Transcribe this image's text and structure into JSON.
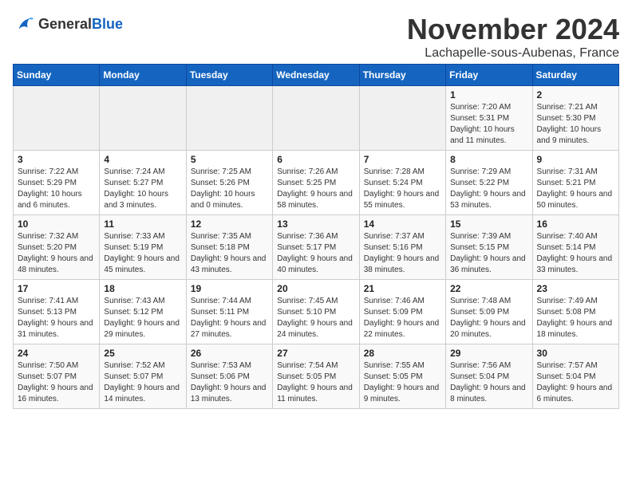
{
  "header": {
    "logo_general": "General",
    "logo_blue": "Blue",
    "month_title": "November 2024",
    "subtitle": "Lachapelle-sous-Aubenas, France"
  },
  "days_of_week": [
    "Sunday",
    "Monday",
    "Tuesday",
    "Wednesday",
    "Thursday",
    "Friday",
    "Saturday"
  ],
  "weeks": [
    [
      {
        "day": "",
        "info": ""
      },
      {
        "day": "",
        "info": ""
      },
      {
        "day": "",
        "info": ""
      },
      {
        "day": "",
        "info": ""
      },
      {
        "day": "",
        "info": ""
      },
      {
        "day": "1",
        "info": "Sunrise: 7:20 AM\nSunset: 5:31 PM\nDaylight: 10 hours and 11 minutes."
      },
      {
        "day": "2",
        "info": "Sunrise: 7:21 AM\nSunset: 5:30 PM\nDaylight: 10 hours and 9 minutes."
      }
    ],
    [
      {
        "day": "3",
        "info": "Sunrise: 7:22 AM\nSunset: 5:29 PM\nDaylight: 10 hours and 6 minutes."
      },
      {
        "day": "4",
        "info": "Sunrise: 7:24 AM\nSunset: 5:27 PM\nDaylight: 10 hours and 3 minutes."
      },
      {
        "day": "5",
        "info": "Sunrise: 7:25 AM\nSunset: 5:26 PM\nDaylight: 10 hours and 0 minutes."
      },
      {
        "day": "6",
        "info": "Sunrise: 7:26 AM\nSunset: 5:25 PM\nDaylight: 9 hours and 58 minutes."
      },
      {
        "day": "7",
        "info": "Sunrise: 7:28 AM\nSunset: 5:24 PM\nDaylight: 9 hours and 55 minutes."
      },
      {
        "day": "8",
        "info": "Sunrise: 7:29 AM\nSunset: 5:22 PM\nDaylight: 9 hours and 53 minutes."
      },
      {
        "day": "9",
        "info": "Sunrise: 7:31 AM\nSunset: 5:21 PM\nDaylight: 9 hours and 50 minutes."
      }
    ],
    [
      {
        "day": "10",
        "info": "Sunrise: 7:32 AM\nSunset: 5:20 PM\nDaylight: 9 hours and 48 minutes."
      },
      {
        "day": "11",
        "info": "Sunrise: 7:33 AM\nSunset: 5:19 PM\nDaylight: 9 hours and 45 minutes."
      },
      {
        "day": "12",
        "info": "Sunrise: 7:35 AM\nSunset: 5:18 PM\nDaylight: 9 hours and 43 minutes."
      },
      {
        "day": "13",
        "info": "Sunrise: 7:36 AM\nSunset: 5:17 PM\nDaylight: 9 hours and 40 minutes."
      },
      {
        "day": "14",
        "info": "Sunrise: 7:37 AM\nSunset: 5:16 PM\nDaylight: 9 hours and 38 minutes."
      },
      {
        "day": "15",
        "info": "Sunrise: 7:39 AM\nSunset: 5:15 PM\nDaylight: 9 hours and 36 minutes."
      },
      {
        "day": "16",
        "info": "Sunrise: 7:40 AM\nSunset: 5:14 PM\nDaylight: 9 hours and 33 minutes."
      }
    ],
    [
      {
        "day": "17",
        "info": "Sunrise: 7:41 AM\nSunset: 5:13 PM\nDaylight: 9 hours and 31 minutes."
      },
      {
        "day": "18",
        "info": "Sunrise: 7:43 AM\nSunset: 5:12 PM\nDaylight: 9 hours and 29 minutes."
      },
      {
        "day": "19",
        "info": "Sunrise: 7:44 AM\nSunset: 5:11 PM\nDaylight: 9 hours and 27 minutes."
      },
      {
        "day": "20",
        "info": "Sunrise: 7:45 AM\nSunset: 5:10 PM\nDaylight: 9 hours and 24 minutes."
      },
      {
        "day": "21",
        "info": "Sunrise: 7:46 AM\nSunset: 5:09 PM\nDaylight: 9 hours and 22 minutes."
      },
      {
        "day": "22",
        "info": "Sunrise: 7:48 AM\nSunset: 5:09 PM\nDaylight: 9 hours and 20 minutes."
      },
      {
        "day": "23",
        "info": "Sunrise: 7:49 AM\nSunset: 5:08 PM\nDaylight: 9 hours and 18 minutes."
      }
    ],
    [
      {
        "day": "24",
        "info": "Sunrise: 7:50 AM\nSunset: 5:07 PM\nDaylight: 9 hours and 16 minutes."
      },
      {
        "day": "25",
        "info": "Sunrise: 7:52 AM\nSunset: 5:07 PM\nDaylight: 9 hours and 14 minutes."
      },
      {
        "day": "26",
        "info": "Sunrise: 7:53 AM\nSunset: 5:06 PM\nDaylight: 9 hours and 13 minutes."
      },
      {
        "day": "27",
        "info": "Sunrise: 7:54 AM\nSunset: 5:05 PM\nDaylight: 9 hours and 11 minutes."
      },
      {
        "day": "28",
        "info": "Sunrise: 7:55 AM\nSunset: 5:05 PM\nDaylight: 9 hours and 9 minutes."
      },
      {
        "day": "29",
        "info": "Sunrise: 7:56 AM\nSunset: 5:04 PM\nDaylight: 9 hours and 8 minutes."
      },
      {
        "day": "30",
        "info": "Sunrise: 7:57 AM\nSunset: 5:04 PM\nDaylight: 9 hours and 6 minutes."
      }
    ]
  ]
}
